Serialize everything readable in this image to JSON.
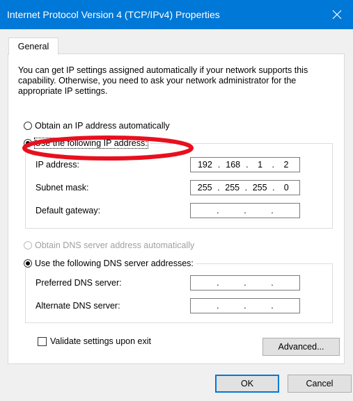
{
  "window": {
    "title": "Internet Protocol Version 4 (TCP/IPv4) Properties",
    "close_icon": "close-icon"
  },
  "tabs": [
    {
      "label": "General",
      "selected": true
    }
  ],
  "description": "You can get IP settings assigned automatically if your network supports this capability. Otherwise, you need to ask your network administrator for the appropriate IP settings.",
  "ip_section": {
    "auto_label": "Obtain an IP address automatically",
    "manual_label": "Use the following IP address:",
    "selected": "manual",
    "fields": [
      {
        "label": "IP address:",
        "octets": [
          "192",
          "168",
          "1",
          "2"
        ]
      },
      {
        "label": "Subnet mask:",
        "octets": [
          "255",
          "255",
          "255",
          "0"
        ]
      },
      {
        "label": "Default gateway:",
        "octets": [
          "",
          "",
          "",
          ""
        ]
      }
    ]
  },
  "dns_section": {
    "auto_label": "Obtain DNS server address automatically",
    "auto_enabled": false,
    "manual_label": "Use the following DNS server addresses:",
    "selected": "manual",
    "fields": [
      {
        "label": "Preferred DNS server:",
        "octets": [
          "",
          "",
          "",
          ""
        ]
      },
      {
        "label": "Alternate DNS server:",
        "octets": [
          "",
          "",
          "",
          ""
        ]
      }
    ]
  },
  "validate_label": "Validate settings upon exit",
  "validate_checked": false,
  "buttons": {
    "advanced": "Advanced...",
    "ok": "OK",
    "cancel": "Cancel"
  },
  "colors": {
    "titlebar": "#0078d7",
    "annotation": "#e8101e"
  }
}
